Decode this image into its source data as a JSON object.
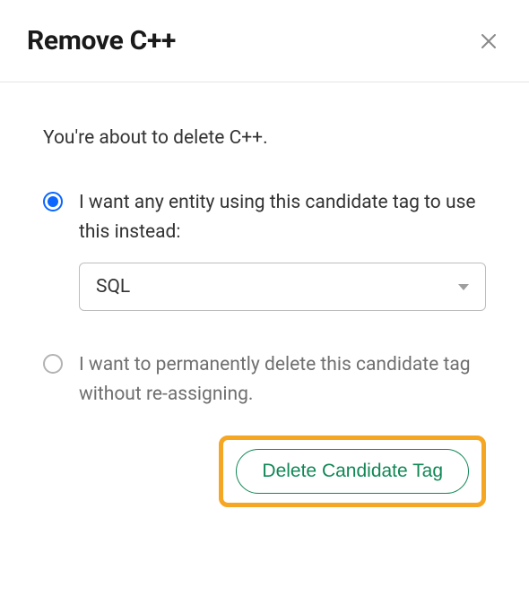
{
  "header": {
    "title": "Remove C++"
  },
  "body": {
    "intro": "You're about to delete C++.",
    "option_reassign": "I want any entity using this candidate tag to use this instead:",
    "select_value": "SQL",
    "option_delete": "I want to permanently delete this candidate tag without re-assigning.",
    "delete_button": "Delete Candidate Tag"
  }
}
